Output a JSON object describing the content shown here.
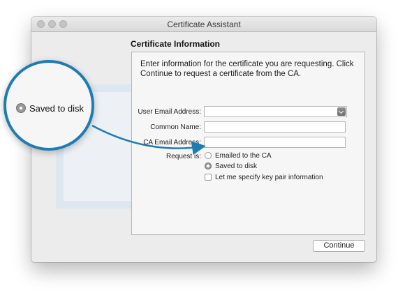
{
  "window": {
    "title": "Certificate Assistant"
  },
  "section": {
    "title": "Certificate Information"
  },
  "intro_text": "Enter information for the certificate you are requesting. Click Continue to request a certificate from the CA.",
  "form": {
    "user_email_label": "User Email Address:",
    "user_email_value": "",
    "common_name_label": "Common Name:",
    "common_name_value": "",
    "ca_email_label": "CA Email Address:",
    "ca_email_value": "",
    "request_is_label": "Request is:",
    "options": [
      {
        "label": "Emailed to the CA",
        "selected": false
      },
      {
        "label": "Saved to disk",
        "selected": true
      }
    ],
    "key_pair_checkbox_label": "Let me specify key pair information",
    "key_pair_checked": false
  },
  "continue_label": "Continue",
  "callout": {
    "label": "Saved to disk",
    "colors": {
      "accent": "#1f7cb2"
    }
  }
}
